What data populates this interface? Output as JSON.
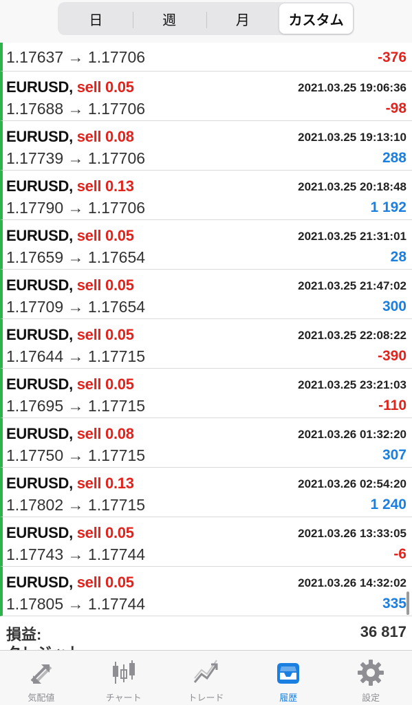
{
  "segment": {
    "items": [
      "日",
      "週",
      "月",
      "カスタム"
    ],
    "selected": "カスタム"
  },
  "partial_row": {
    "prices": "1.17637 → 1.17706",
    "profit": "-376"
  },
  "trades": [
    {
      "symbol": "EURUSD,",
      "side": "sell 0.05",
      "datetime": "2021.03.25 19:06:36",
      "prices": "1.17688 → 1.17706",
      "profit": "-98"
    },
    {
      "symbol": "EURUSD,",
      "side": "sell 0.08",
      "datetime": "2021.03.25 19:13:10",
      "prices": "1.17739 → 1.17706",
      "profit": "288"
    },
    {
      "symbol": "EURUSD,",
      "side": "sell 0.13",
      "datetime": "2021.03.25 20:18:48",
      "prices": "1.17790 → 1.17706",
      "profit": "1 192"
    },
    {
      "symbol": "EURUSD,",
      "side": "sell 0.05",
      "datetime": "2021.03.25 21:31:01",
      "prices": "1.17659 → 1.17654",
      "profit": "28"
    },
    {
      "symbol": "EURUSD,",
      "side": "sell 0.05",
      "datetime": "2021.03.25 21:47:02",
      "prices": "1.17709 → 1.17654",
      "profit": "300"
    },
    {
      "symbol": "EURUSD,",
      "side": "sell 0.05",
      "datetime": "2021.03.25 22:08:22",
      "prices": "1.17644 → 1.17715",
      "profit": "-390"
    },
    {
      "symbol": "EURUSD,",
      "side": "sell 0.05",
      "datetime": "2021.03.25 23:21:03",
      "prices": "1.17695 → 1.17715",
      "profit": "-110"
    },
    {
      "symbol": "EURUSD,",
      "side": "sell 0.08",
      "datetime": "2021.03.26 01:32:20",
      "prices": "1.17750 → 1.17715",
      "profit": "307"
    },
    {
      "symbol": "EURUSD,",
      "side": "sell 0.13",
      "datetime": "2021.03.26 02:54:20",
      "prices": "1.17802 → 1.17715",
      "profit": "1 240"
    },
    {
      "symbol": "EURUSD,",
      "side": "sell 0.05",
      "datetime": "2021.03.26 13:33:05",
      "prices": "1.17743 → 1.17744",
      "profit": "-6"
    },
    {
      "symbol": "EURUSD,",
      "side": "sell 0.05",
      "datetime": "2021.03.26 14:32:02",
      "prices": "1.17805 → 1.17744",
      "profit": "335"
    }
  ],
  "summary": {
    "label": "損益:",
    "value": "36 817",
    "next_label_partial": "クレジット"
  },
  "tabbar": [
    {
      "label": "気配値",
      "icon": "quotes-icon",
      "active": false
    },
    {
      "label": "チャート",
      "icon": "chart-candles-icon",
      "active": false
    },
    {
      "label": "トレード",
      "icon": "trade-icon",
      "active": false
    },
    {
      "label": "履歴",
      "icon": "history-inbox-icon",
      "active": true
    },
    {
      "label": "設定",
      "icon": "gear-icon",
      "active": false
    }
  ],
  "colors": {
    "loss": "#e0231c",
    "gain": "#1a7fe0",
    "row_marker": "#2db34a",
    "active_tab": "#1a7fe0"
  }
}
